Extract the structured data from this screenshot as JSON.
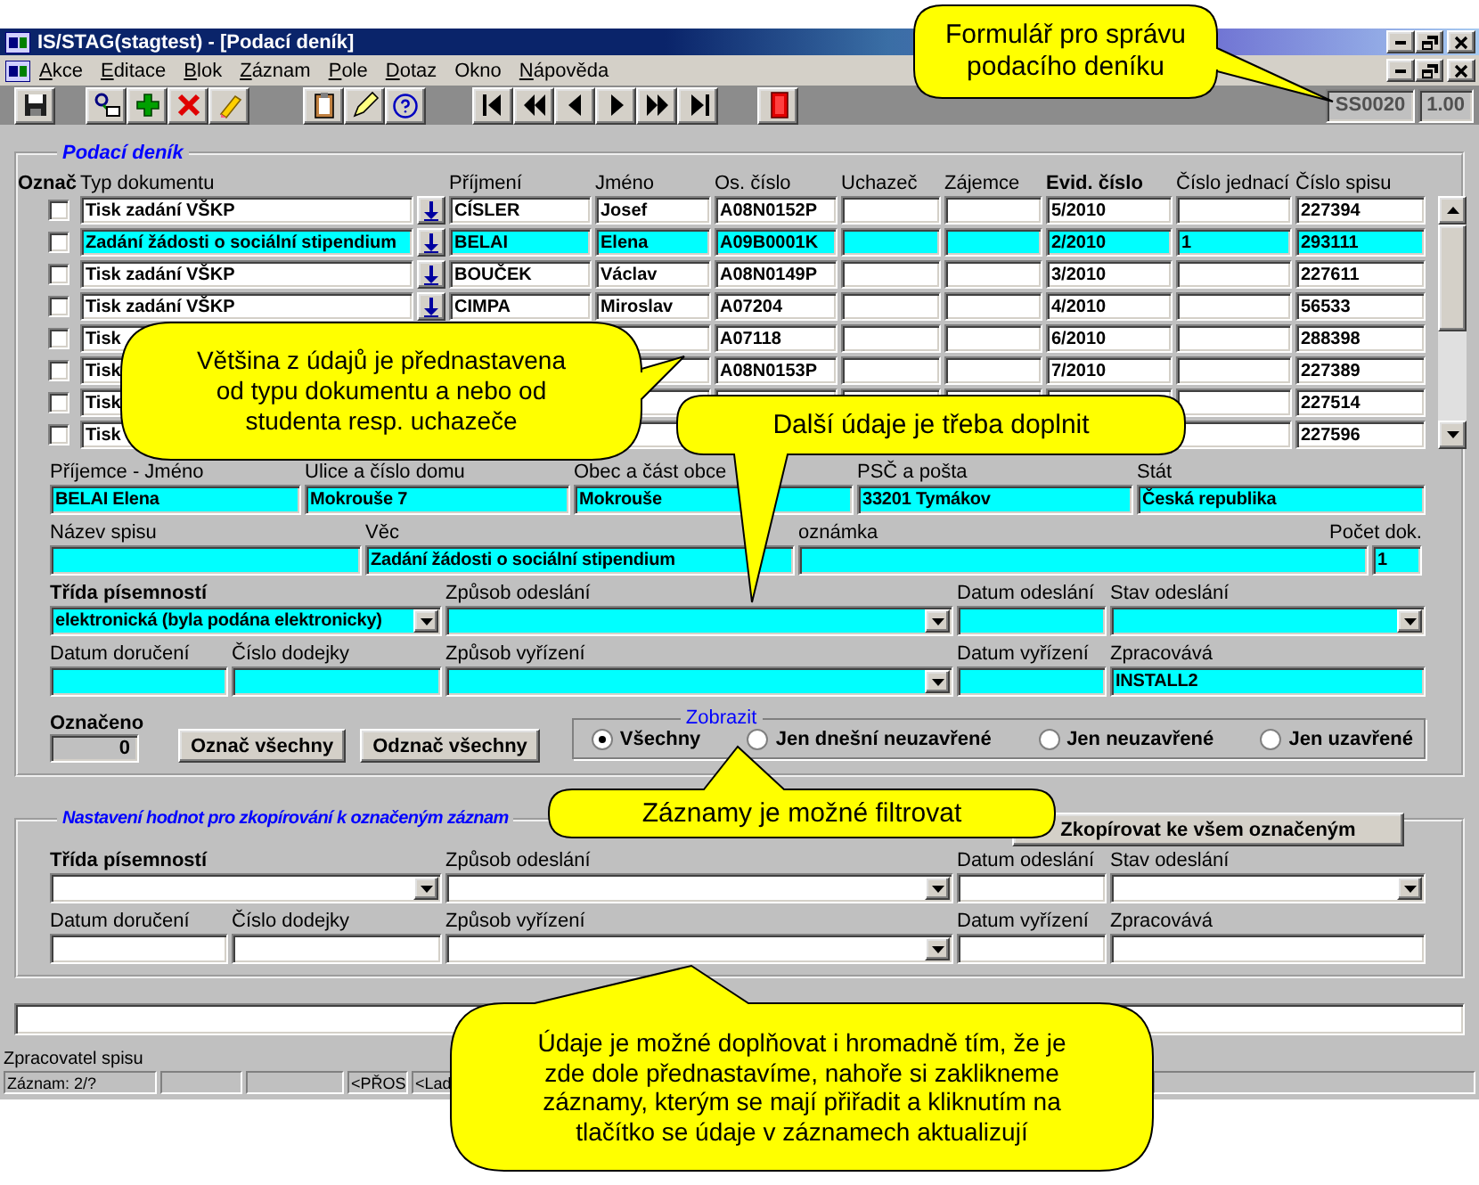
{
  "window": {
    "title": "IS/STAG(stagtest) - [Podací deník]"
  },
  "menu": [
    {
      "label": "Akce",
      "mnemonic": true
    },
    {
      "label": "Editace",
      "mnemonic": true
    },
    {
      "label": "Blok",
      "mnemonic": true
    },
    {
      "label": "Záznam",
      "mnemonic": true
    },
    {
      "label": "Pole",
      "mnemonic": true
    },
    {
      "label": "Dotaz",
      "mnemonic": true
    },
    {
      "label": "Okno",
      "mnemonic": false
    },
    {
      "label": "Nápověda",
      "mnemonic": true
    }
  ],
  "toolbar": {
    "form_code": "SS0020",
    "version": "1.00"
  },
  "records": {
    "title": "Podací deník",
    "columns": [
      {
        "label": "Označ",
        "bold": true
      },
      {
        "label": "Typ dokumentu",
        "bold": false
      },
      {
        "label": "Příjmení",
        "bold": false
      },
      {
        "label": "Jméno",
        "bold": false
      },
      {
        "label": "Os. číslo",
        "bold": false
      },
      {
        "label": "Uchazeč",
        "bold": false
      },
      {
        "label": "Zájemce",
        "bold": false
      },
      {
        "label": "Evid. číslo",
        "bold": true
      },
      {
        "label": "Číslo jednací",
        "bold": false
      },
      {
        "label": "Číslo spisu",
        "bold": false
      }
    ],
    "rows": [
      {
        "checked": false,
        "selected": false,
        "arrow_button": true,
        "typ": "Tisk zadání VŠKP",
        "prijmeni": "CÍSLER",
        "jmeno": "Josef",
        "os_cislo": "A08N0152P",
        "evid": "5/2010",
        "spis": "227394"
      },
      {
        "checked": false,
        "selected": true,
        "arrow_button": true,
        "typ": "Zadání žádosti o sociální stipendium",
        "prijmeni": "BELAI",
        "jmeno": "Elena",
        "os_cislo": "A09B0001K",
        "evid": "2/2010",
        "jednaci": "1",
        "spis": "293111"
      },
      {
        "checked": false,
        "selected": false,
        "arrow_button": true,
        "typ": "Tisk zadání VŠKP",
        "prijmeni": "BOUČEK",
        "jmeno": "Václav",
        "os_cislo": "A08N0149P",
        "evid": "3/2010",
        "spis": "227611"
      },
      {
        "checked": false,
        "selected": false,
        "arrow_button": true,
        "typ": "Tisk zadání VŠKP",
        "prijmeni": "CIMPA",
        "jmeno": "Miroslav",
        "os_cislo": "A07204",
        "evid": "4/2010",
        "spis": "56533"
      },
      {
        "checked": false,
        "selected": false,
        "arrow_button": false,
        "typ": "Tisk",
        "os_cislo": "A07118",
        "evid": "6/2010",
        "spis": "288398"
      },
      {
        "checked": false,
        "selected": false,
        "arrow_button": false,
        "typ": "Tisk",
        "os_cislo": "A08N0153P",
        "evid": "7/2010",
        "spis": "227389"
      },
      {
        "checked": false,
        "selected": false,
        "arrow_button": false,
        "typ": "Tisk",
        "spis": "227514"
      },
      {
        "checked": false,
        "selected": false,
        "arrow_button": false,
        "typ": "Tisk",
        "spis": "227596"
      }
    ]
  },
  "detail": {
    "active": true,
    "fields": [
      {
        "label": "Příjemce - Jméno",
        "value": "BELAI Elena",
        "kind": "text"
      },
      {
        "label": "Ulice a číslo domu",
        "value": "Mokrouše 7",
        "kind": "text"
      },
      {
        "label": "Obec a část obce",
        "value": "Mokrouše",
        "kind": "text"
      },
      {
        "label": "PSČ a pošta",
        "value": "33201 Tymákov",
        "kind": "text"
      },
      {
        "label": "Stát",
        "value": "Česká republika",
        "kind": "text"
      },
      {
        "label": "Název spisu",
        "kind": "text"
      },
      {
        "label": "Věc",
        "value": "Zadání žádosti o sociální stipendium",
        "kind": "text"
      },
      {
        "label": "oznámka",
        "kind": "text"
      },
      {
        "label": "Počet dok.",
        "value": "1",
        "kind": "text"
      },
      {
        "label": "Třída písemností",
        "bold": true,
        "value": "elektronická (byla podána elektronicky)",
        "kind": "select"
      },
      {
        "label": "Způsob odeslání",
        "kind": "select"
      },
      {
        "label": "Datum odeslání",
        "kind": "text"
      },
      {
        "label": "Stav odeslání",
        "kind": "select"
      },
      {
        "label": "Datum doručení",
        "kind": "text"
      },
      {
        "label": "Číslo dodejky",
        "kind": "text"
      },
      {
        "label": "Způsob vyřízení",
        "kind": "select"
      },
      {
        "label": "Datum vyřízení",
        "kind": "text"
      },
      {
        "label": "Zpracovává",
        "value": "INSTALL2",
        "kind": "text"
      }
    ]
  },
  "marked": {
    "label": "Označeno",
    "value": "0",
    "buttons": [
      "Označ všechny",
      "Odznač všechny"
    ]
  },
  "filter": {
    "title": "Zobrazit",
    "options": [
      {
        "label": "Všechny",
        "selected": true
      },
      {
        "label": "Jen dnešní neuzavřené",
        "selected": false
      },
      {
        "label": "Jen neuzavřené",
        "selected": false
      },
      {
        "label": "Jen uzavřené",
        "selected": false
      }
    ]
  },
  "copy": {
    "title": "Nastavení hodnot pro zkopírování k označeným záznam",
    "button": "Zkopírovat ke všem označeným",
    "active": false,
    "fields": [
      {
        "label": "Třída písemností",
        "bold": true,
        "kind": "select"
      },
      {
        "label": "Způsob odeslání",
        "kind": "select"
      },
      {
        "label": "Datum odeslání",
        "kind": "text"
      },
      {
        "label": "Stav odeslání",
        "kind": "select"
      },
      {
        "label": "Datum doručení",
        "kind": "text"
      },
      {
        "label": "Číslo dodejky",
        "kind": "text"
      },
      {
        "label": "Způsob vyřízení",
        "kind": "select"
      },
      {
        "label": "Datum vyřízení",
        "kind": "text"
      },
      {
        "label": "Zpracovává",
        "kind": "text"
      }
    ]
  },
  "status": {
    "hint": "Zpracovatel spisu",
    "cells": [
      "Záznam: 2/?",
      "<PŘOS",
      "<Lad"
    ]
  },
  "callouts": [
    "Formulář pro správu podacího deníku",
    "Většina z údajů je přednastavena od typu dokumentu a nebo od studenta resp. uchazeče",
    "Další údaje je třeba doplnit",
    "Záznamy je možné filtrovat",
    "Údaje je možné doplňovat i hromadně tím, že je zde dole přednastavíme, nahoře si zaklikneme záznamy, kterým se mají přiřadit a kliknutím na tlačítko se údaje v záznamech aktualizují"
  ]
}
